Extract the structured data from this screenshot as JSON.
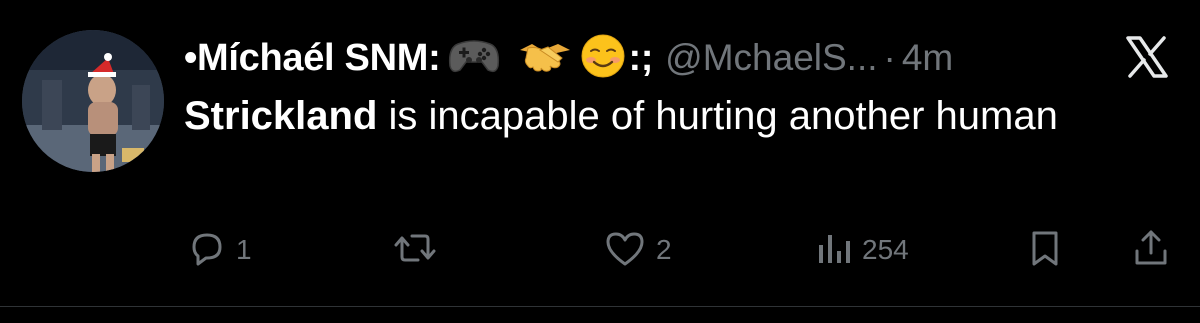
{
  "tweet": {
    "display_name": "•Míchaél SNM:",
    "name_suffix": ":;",
    "handle": "@MchaelS...",
    "separator": "·",
    "time": "4m",
    "text_bold": "Strickland",
    "text_rest": " is incapable of hurting another human",
    "emojis": [
      "game-controller-emoji",
      "handshake-emoji",
      "smiling-face-emoji"
    ]
  },
  "actions": {
    "reply_count": "1",
    "retweet_count": "",
    "like_count": "2",
    "views_count": "254"
  },
  "colors": {
    "background": "#000000",
    "primary_text": "#ffffff",
    "secondary_text": "#71767b",
    "divider": "#2f3336"
  },
  "icons": [
    "x-logo-icon",
    "reply-icon",
    "retweet-icon",
    "like-icon",
    "views-icon",
    "bookmark-icon",
    "share-icon"
  ]
}
